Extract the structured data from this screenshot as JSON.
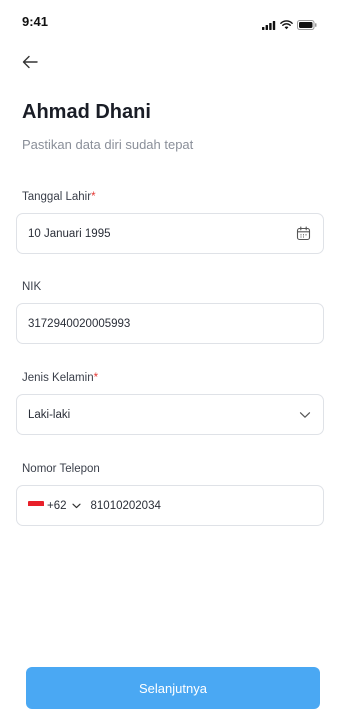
{
  "status_bar": {
    "time": "9:41",
    "icons": [
      "signal-icon",
      "wifi-icon",
      "battery-icon"
    ]
  },
  "nav": {
    "back_icon": "arrow-left-icon"
  },
  "header": {
    "title": "Ahmad Dhani",
    "subtitle": "Pastikan data diri sudah tepat"
  },
  "form": {
    "birth_date": {
      "label": "Tanggal Lahir",
      "required_mark": "*",
      "value": "10 Januari 1995",
      "icon": "calendar-icon"
    },
    "nik": {
      "label": "NIK",
      "value": "3172940020005993"
    },
    "gender": {
      "label": "Jenis Kelamin",
      "required_mark": "*",
      "value": "Laki-laki",
      "icon": "chevron-down-icon"
    },
    "phone": {
      "label": "Nomor Telepon",
      "country_flag": "indonesia-flag-icon",
      "country_code": "+62",
      "value": "81010202034"
    }
  },
  "actions": {
    "next_label": "Selanjutnya"
  },
  "colors": {
    "primary": "#4aa8f3",
    "required": "#e53935",
    "border": "#dfe2e7",
    "muted_text": "#8a8f99"
  }
}
